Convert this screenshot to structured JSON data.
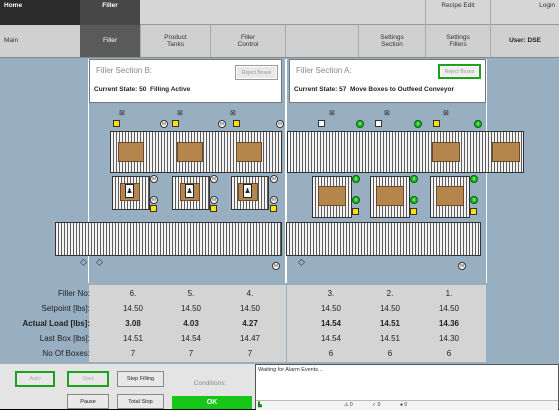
{
  "nav_top": {
    "home": "Home",
    "filler": "Filler",
    "recipe_edit": "Recipe Edit",
    "login": "Login"
  },
  "nav_sub": {
    "main": "Main",
    "filler": "Filler",
    "product_tanks": "Product\nTanks",
    "filler_control": "Filler\nControl",
    "settings_section": "Settings\nSection",
    "settings_fillers": "Settings\nFillers",
    "user": "User: DSE"
  },
  "section_b": {
    "title": "Filler Section B:",
    "reject_label": "Reject Boxes",
    "state_label": "Current State: 50",
    "state_text": "Filling Active"
  },
  "section_a": {
    "title": "Filler Section A:",
    "reject_label": "Reject Boxes",
    "state_label": "Current State: 57",
    "state_text": "Move Boxes to Outfeed Conveyor"
  },
  "icons": {
    "motor": "M",
    "sensor": "S"
  },
  "table": {
    "labels": [
      "Filler No:",
      "Setpoint [lbs]:",
      "Actual Load [lbs]:",
      "Last Box [lbs]:",
      "No Of Boxes:"
    ],
    "fillers": [
      "6.",
      "5.",
      "4.",
      "3.",
      "2.",
      "1."
    ],
    "setpoint": [
      "14.50",
      "14.50",
      "14.50",
      "14.50",
      "14.50",
      "14.50"
    ],
    "actual": [
      "3.08",
      "4.03",
      "4.27",
      "14.54",
      "14.51",
      "14.36"
    ],
    "last_box": [
      "14.51",
      "14.54",
      "14.47",
      "14.54",
      "14.51",
      "14.30"
    ],
    "boxes": [
      "7",
      "7",
      "7",
      "6",
      "6",
      "6"
    ]
  },
  "controls": {
    "auto": "Auto",
    "start": "Start",
    "step_filling": "Step Filling",
    "pause": "Pause",
    "total_stop": "Total Stop",
    "conditions": "Conditions:",
    "ok": "OK"
  },
  "alarm": {
    "text": "Waiting for Alarm Events...",
    "c1": "0",
    "c2": "0",
    "c3": "0"
  },
  "colors": {
    "accent_green": "#1aa21a",
    "main_bg": "#98aec1"
  }
}
